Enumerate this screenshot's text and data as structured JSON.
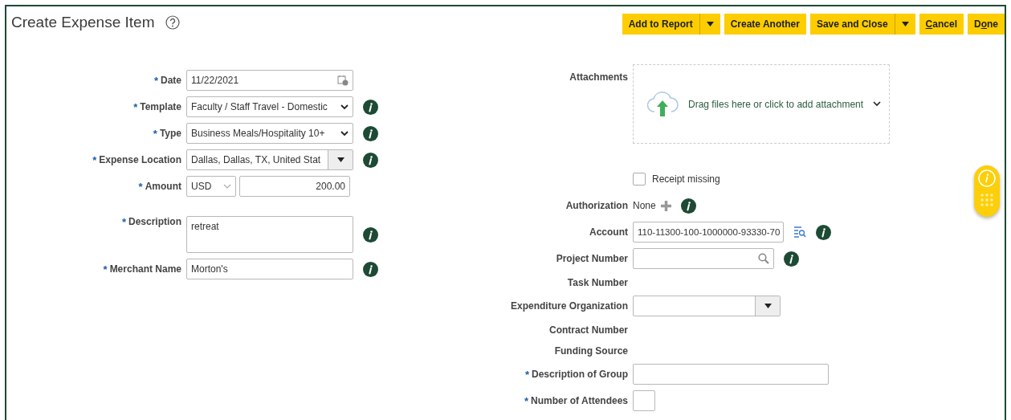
{
  "title": "Create Expense Item",
  "toolbar": [
    {
      "label": "Add to Report",
      "kind": "split"
    },
    {
      "label": "Create Another",
      "kind": "plain"
    },
    {
      "label": "Save and Close",
      "kind": "split"
    },
    {
      "kind": "access",
      "key": "C",
      "after": "ancel"
    },
    {
      "kind": "access",
      "before": "D",
      "key": "o",
      "after": "ne"
    }
  ],
  "left_fields": [
    {
      "label": "Date",
      "required_mark": "*",
      "kind": "date",
      "value": "11/22/2021",
      "info": false
    },
    {
      "label": "Template",
      "required_mark": "*",
      "kind": "select",
      "value": "Faculty / Staff Travel - Domestic",
      "info": true
    },
    {
      "label": "Type",
      "required_mark": "*",
      "kind": "select",
      "value": "Business Meals/Hospitality 10+",
      "info": true
    },
    {
      "label": "Expense Location",
      "required_mark": "*",
      "kind": "combo",
      "value": "Dallas, Dallas, TX, United Stat",
      "info": true
    },
    {
      "label": "Amount",
      "required_mark": "*",
      "kind": "amount",
      "currency": "USD",
      "value": "200.00",
      "info": false
    },
    {
      "label": "Description",
      "required_mark": "*",
      "kind": "textarea",
      "value": "retreat",
      "info": true
    },
    {
      "label": "Merchant Name",
      "required_mark": "*",
      "kind": "text",
      "value": "Morton's",
      "info": true
    }
  ],
  "right_fields": [
    {
      "label": "Attachments",
      "kind": "attachments",
      "hint": "Drag files here or click to add attachment",
      "info": false
    },
    {
      "label": "Receipt missing",
      "kind": "checkbox",
      "checked": false
    },
    {
      "label": "Authorization",
      "kind": "add",
      "value": "None",
      "info": true
    },
    {
      "label": "Account",
      "kind": "lookup",
      "value": "110-11300-100-1000000-93330-70",
      "info": true
    },
    {
      "label": "Project Number",
      "kind": "search",
      "info": true
    },
    {
      "label": "Task Number",
      "kind": "static",
      "info": false
    },
    {
      "label": "Expenditure Organization",
      "kind": "combo",
      "info": false
    },
    {
      "label": "Contract Number",
      "kind": "static",
      "info": false
    },
    {
      "label": "Funding Source",
      "kind": "static",
      "info": false
    },
    {
      "label": "Description of Group",
      "required_mark": "*",
      "kind": "text",
      "info": false
    },
    {
      "label": "Number of Attendees",
      "required_mark": "*",
      "kind": "number",
      "info": false
    }
  ]
}
